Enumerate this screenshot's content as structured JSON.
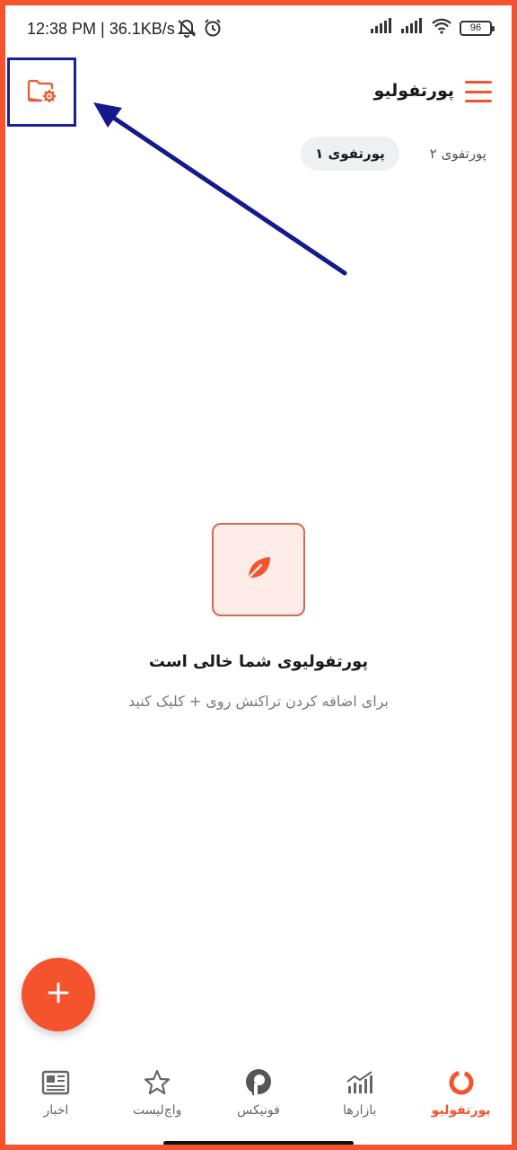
{
  "status_bar": {
    "time_speed": "12:38 PM | 36.1KB/s",
    "battery": "96",
    "icons": [
      "mute-icon",
      "alarm-icon",
      "signal-icon",
      "signal-icon",
      "wifi-icon",
      "battery-icon"
    ]
  },
  "header": {
    "title": "پورتفولیو",
    "folder_icon": "folder-settings-icon",
    "menu_icon": "hamburger-menu-icon"
  },
  "tabs": [
    {
      "label": "پورتفوی ۱",
      "active": true
    },
    {
      "label": "پورتفوی ۲",
      "active": false
    }
  ],
  "empty_state": {
    "icon": "leaf-icon",
    "title": "پورتفولیوی شما خالی است",
    "subtitle": "برای اضافه کردن تراکنش روی + کلیک کنید"
  },
  "fab": {
    "icon": "plus-icon"
  },
  "bottom_nav": [
    {
      "label": "پورتفولیو",
      "icon": "portfolio-ring-icon",
      "active": true
    },
    {
      "label": "بازارها",
      "icon": "markets-chart-icon",
      "active": false
    },
    {
      "label": "فونیکس",
      "icon": "fonix-logo-icon",
      "active": false
    },
    {
      "label": "واچ‌لیست",
      "icon": "star-icon",
      "active": false
    },
    {
      "label": "اخبار",
      "icon": "news-icon",
      "active": false
    }
  ],
  "colors": {
    "accent": "#f5532d",
    "highlight_box": "#1a1f9e",
    "arrow": "#141a8c"
  }
}
